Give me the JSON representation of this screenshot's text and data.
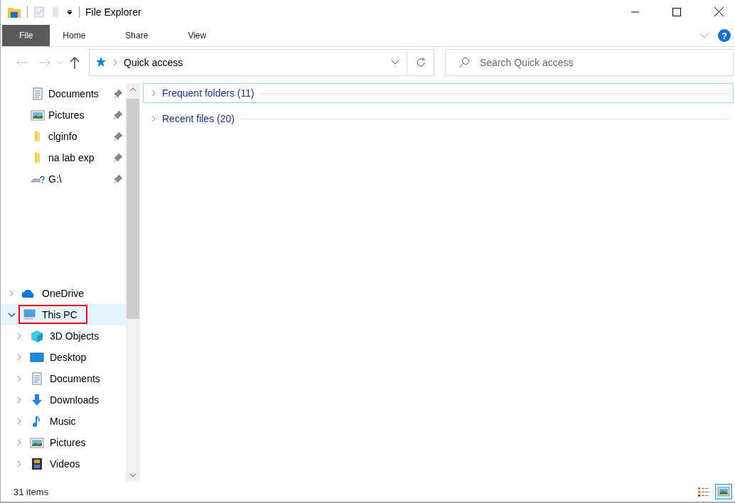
{
  "window": {
    "title": "File Explorer"
  },
  "ribbon": {
    "tabs": [
      {
        "label": "File",
        "kind": "file",
        "selected": false
      },
      {
        "label": "Home",
        "kind": "tab",
        "selected": false
      },
      {
        "label": "Share",
        "kind": "tab",
        "selected": false
      },
      {
        "label": "View",
        "kind": "tab",
        "selected": false
      }
    ],
    "help": "?"
  },
  "address": {
    "location": "Quick access"
  },
  "search": {
    "placeholder": "Search Quick access"
  },
  "navigation": {
    "pinned": [
      {
        "label": "Documents",
        "kind": "documents",
        "pinned": true
      },
      {
        "label": "Pictures",
        "kind": "pictures",
        "pinned": true
      },
      {
        "label": "clginfo",
        "kind": "folder",
        "pinned": true
      },
      {
        "label": "na lab exp",
        "kind": "folder",
        "pinned": true
      },
      {
        "label": "G:\\",
        "kind": "drive",
        "pinned": true
      }
    ],
    "tree": [
      {
        "label": "OneDrive",
        "kind": "cloud",
        "expanded": false,
        "selected": false,
        "highlighted": false
      },
      {
        "label": "This PC",
        "kind": "pc",
        "expanded": true,
        "selected": true,
        "highlighted": true,
        "children": [
          {
            "label": "3D Objects",
            "kind": "cube",
            "expanded": false
          },
          {
            "label": "Desktop",
            "kind": "desktop",
            "expanded": false
          },
          {
            "label": "Documents",
            "kind": "documents",
            "expanded": false
          },
          {
            "label": "Downloads",
            "kind": "download",
            "expanded": false
          },
          {
            "label": "Music",
            "kind": "music",
            "expanded": false
          },
          {
            "label": "Pictures",
            "kind": "pictures",
            "expanded": false
          },
          {
            "label": "Videos",
            "kind": "videos",
            "expanded": false
          }
        ]
      }
    ]
  },
  "groups": [
    {
      "label": "Frequent folders (11)",
      "expanded": false,
      "focused": true
    },
    {
      "label": "Recent files (20)",
      "expanded": false,
      "focused": false
    }
  ],
  "status_bar": {
    "count": "31 items",
    "views": [
      {
        "kind": "details",
        "selected": false
      },
      {
        "kind": "large-icons",
        "selected": true
      }
    ]
  }
}
